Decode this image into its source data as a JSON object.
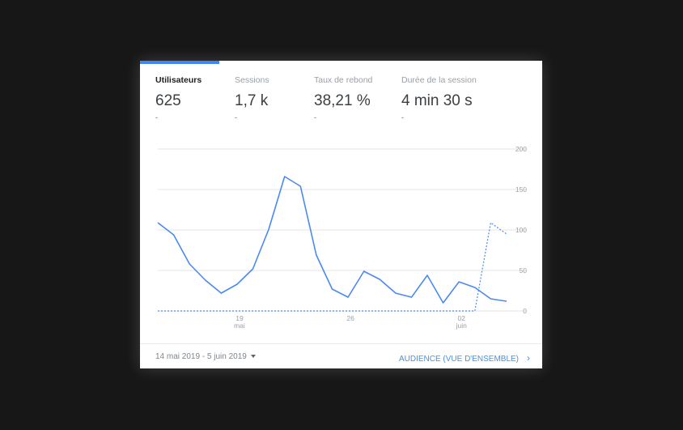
{
  "metrics": [
    {
      "label": "Utilisateurs",
      "value": "625",
      "change": "-"
    },
    {
      "label": "Sessions",
      "value": "1,7 k",
      "change": "-"
    },
    {
      "label": "Taux de rebond",
      "value": "38,21 %",
      "change": "-"
    },
    {
      "label": "Durée de la session",
      "value": "4 min 30 s",
      "change": "-"
    }
  ],
  "footer": {
    "date_range": "14 mai 2019 - 5 juin 2019",
    "audience_link": "AUDIENCE (VUE D'ENSEMBLE)"
  },
  "colors": {
    "accent": "#4285f4",
    "line": "#4a8af0",
    "grid": "#e6e6e6",
    "background": "#171717"
  },
  "chart_data": {
    "type": "line",
    "x": [
      "2019-05-14",
      "2019-05-15",
      "2019-05-16",
      "2019-05-17",
      "2019-05-18",
      "2019-05-19",
      "2019-05-20",
      "2019-05-21",
      "2019-05-22",
      "2019-05-23",
      "2019-05-24",
      "2019-05-25",
      "2019-05-26",
      "2019-05-27",
      "2019-05-28",
      "2019-05-29",
      "2019-05-30",
      "2019-05-31",
      "2019-06-01",
      "2019-06-02",
      "2019-06-03",
      "2019-06-04",
      "2019-06-05"
    ],
    "series": [
      {
        "values": [
          109,
          94,
          58,
          38,
          22,
          33,
          52,
          101,
          166,
          154,
          69,
          27,
          17,
          49,
          39,
          22,
          17,
          44,
          10,
          36,
          29,
          15,
          12
        ]
      },
      {
        "values": [
          0,
          0,
          0,
          0,
          0,
          0,
          0,
          0,
          0,
          0,
          0,
          0,
          0,
          0,
          0,
          0,
          0,
          0,
          0,
          0,
          0,
          109,
          95
        ]
      }
    ],
    "x_tick_labels": [
      {
        "x": "2019-05-19",
        "line1": "19",
        "line2": "mai"
      },
      {
        "x": "2019-05-26",
        "line1": "26",
        "line2": ""
      },
      {
        "x": "2019-06-02",
        "line1": "02",
        "line2": "juin"
      }
    ],
    "y_ticks": [
      0,
      50,
      100,
      150,
      200
    ],
    "ylim": [
      0,
      200
    ],
    "grid": true
  }
}
